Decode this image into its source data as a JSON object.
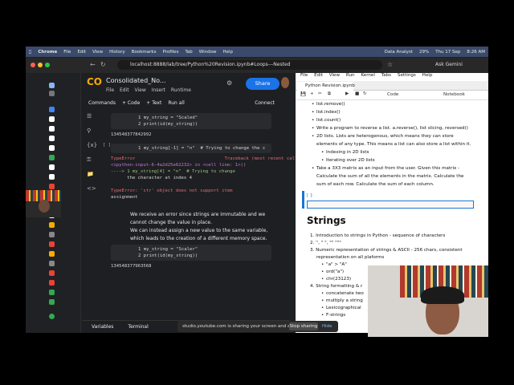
{
  "mac_menubar": {
    "app": "Chrome",
    "items": [
      "File",
      "Edit",
      "View",
      "History",
      "Bookmarks",
      "Profiles",
      "Tab",
      "Window",
      "Help"
    ],
    "right_items": [
      "Data Analyst",
      "29%",
      "Thu 17 Sep",
      "8:26 AM"
    ]
  },
  "chrome": {
    "url": "localhost:8888/lab/tree/Python%20Revision.ipynb#Loops---Nested",
    "ask_gemini": "Ask Gemini"
  },
  "colab": {
    "logo": "CO",
    "title": "Consolidated_No...",
    "menu": [
      "File",
      "Edit",
      "View",
      "Insert",
      "Runtime"
    ],
    "share_label": "Share",
    "cmdbar": [
      "Commands",
      "+ Code",
      "+ Text",
      "Run all",
      "Connect"
    ],
    "cells": [
      {
        "lines": [
          "1 my_string = \"Scaled\"",
          "2 print(id(my_string))"
        ],
        "output": "134548377842992"
      },
      {
        "exec": "[ ]",
        "lines": [
          "1 my_string[-1] = \"n\"  # Trying to change the c"
        ],
        "output_lines": [
          "TypeError                                 Traceback (most recent call last)",
          "<ipython-input-6-4a2d25e62232> in <cell line: 1>()",
          "----> 1 my_string[4] = \"n\"  # Trying to change",
          "      the character at index 4",
          "",
          "TypeError: 'str' object does not support item",
          "assignment"
        ]
      },
      {
        "lines": [
          "1 my_string = \"Scaler\"",
          "2 print(id(my_string))"
        ],
        "output": "134548377963568"
      }
    ],
    "markdown_bullets": [
      "We receive an error since strings are immutable and we cannot change the value in place.",
      "We can instead assign a new value to the same variable, which leads to the creation of a different memory space."
    ],
    "bottom": [
      "Variables",
      "Terminal"
    ]
  },
  "share_banner": {
    "text": "studio.youtube.com is sharing your screen and audio.",
    "stop": "Stop sharing",
    "hide": "Hide"
  },
  "jupyter": {
    "menu": [
      "File",
      "Edit",
      "View",
      "Run",
      "Kernel",
      "Tabs",
      "Settings",
      "Help"
    ],
    "tab": "Python Revision.ipynb",
    "toolbar_mode": "Code",
    "kernel_label": "Notebook",
    "lines": [
      "list.remove()",
      "list.index()",
      "list.count()",
      "Write a program to reverse a list. a.reverse(), list slicing, reversed()",
      "2D lists. Lists are heterogenous, which means they can store",
      "elements of any type. This means a list can also store a list within it.",
      "Indexing in 2D lists",
      "Iterating over 2D lists",
      "Take a 3X3 matrix as an input from the user. Given this matrix -",
      "Calculate the sum of all the elements in the matrix. Calculate the",
      "sum of each row. Calculate the sum of each column."
    ],
    "cell_prompt": "[ ]:",
    "heading": "Strings",
    "string_items": [
      "Introduction to strings in Python - sequence of characters",
      "'', \" \", \"\" \"\"\"",
      "Numeric representation of strings & ASCII - 256 chars, consistent",
      "representation on all plaforms",
      "\"a\" > \"A\"",
      "ord(\"a\")",
      "chr(23123)",
      "String formatting & r",
      "concatenate two",
      "multiply a string",
      "Lexicographical",
      "F-strings"
    ]
  }
}
